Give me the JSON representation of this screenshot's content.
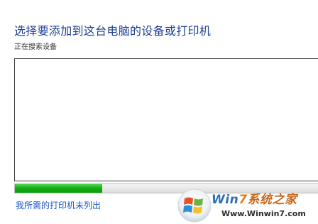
{
  "header": {
    "title": "选择要添加到这台电脑的设备或打印机",
    "status": "正在搜索设备"
  },
  "device_list": {
    "items": []
  },
  "progress": {
    "fraction": 0.28,
    "color": "#14b014"
  },
  "footer": {
    "printer_not_listed_link": "我所需的打印机未列出"
  },
  "watermark": {
    "brand_part1": "Win",
    "brand_part2": "7",
    "brand_part3": "系统之家",
    "url": "Www.Winwin7.com"
  },
  "colors": {
    "title": "#1c3f95",
    "link": "#1a56c8"
  }
}
